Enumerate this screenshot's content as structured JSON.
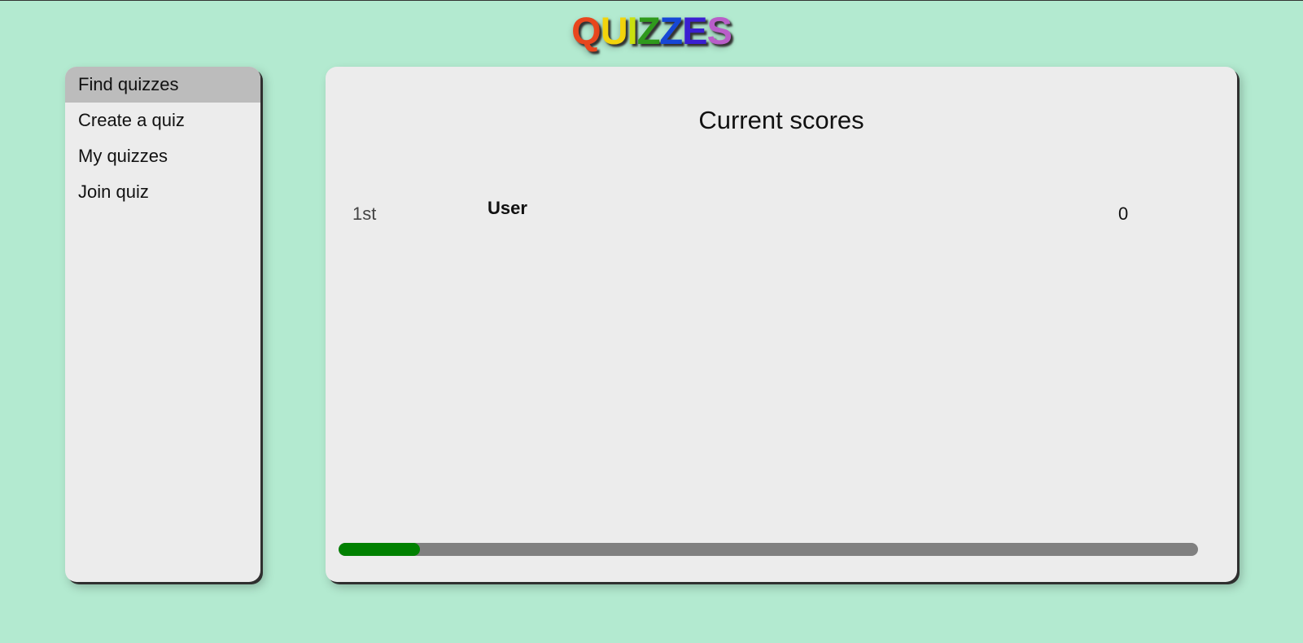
{
  "header": {
    "logo_letters": [
      {
        "char": "Q",
        "color": "#e8461d"
      },
      {
        "char": "U",
        "color": "#f2d40c"
      },
      {
        "char": "I",
        "color": "#c9e00e"
      },
      {
        "char": "Z",
        "color": "#2f9a1c"
      },
      {
        "char": "Z",
        "color": "#1647d6"
      },
      {
        "char": "E",
        "color": "#3a1fd1"
      },
      {
        "char": "S",
        "color": "#b95ec9"
      }
    ]
  },
  "sidebar": {
    "items": [
      {
        "label": "Find quizzes",
        "active": true
      },
      {
        "label": "Create a quiz",
        "active": false
      },
      {
        "label": "My quizzes",
        "active": false
      },
      {
        "label": "Join quiz",
        "active": false
      }
    ]
  },
  "main": {
    "title": "Current scores",
    "scores": [
      {
        "rank": "1st",
        "user": "User",
        "score": "0"
      }
    ],
    "progress": {
      "fraction": 0.095,
      "fill_color": "#008000",
      "track_color": "#808080"
    }
  }
}
